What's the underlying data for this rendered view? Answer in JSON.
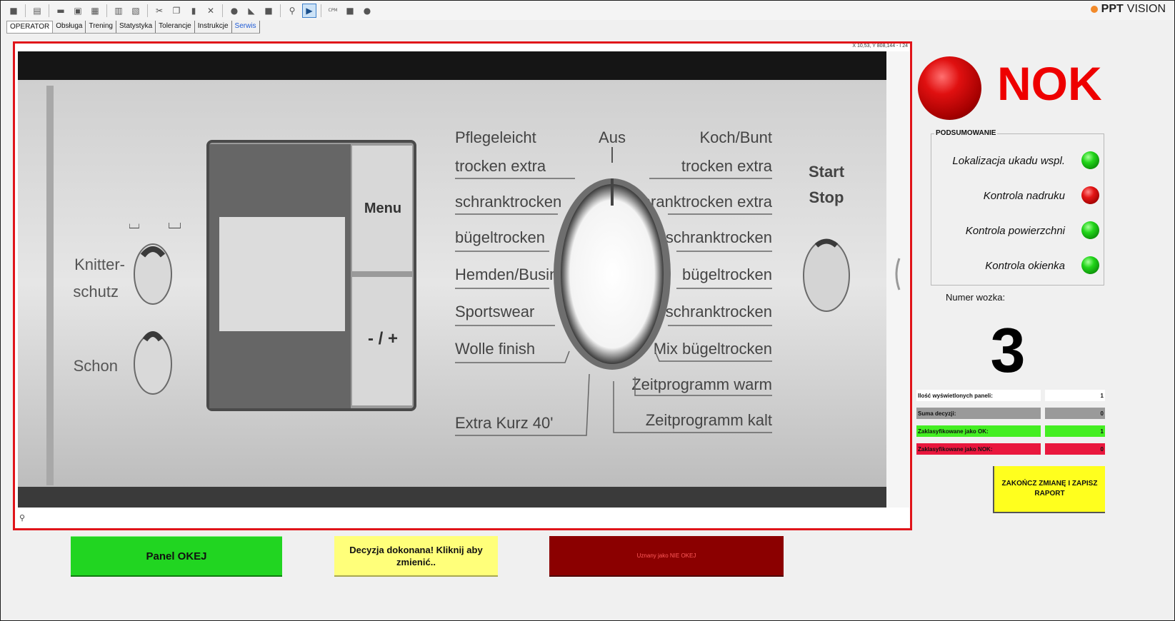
{
  "toolbar": {
    "icons": [
      "window-icon",
      "new-icon",
      "image-icon",
      "camera-icon",
      "folder-icon",
      "layers-icon",
      "export-icon",
      "scissors-icon",
      "copy-icon",
      "paste-icon",
      "delete-icon",
      "tool-icon",
      "fill-icon",
      "stop-icon",
      "search-icon",
      "play-icon",
      "cpm-icon",
      "grid-icon",
      "record-icon"
    ],
    "play_glyph": "▶",
    "cpm_glyph": "CPM"
  },
  "brand": {
    "name_bold": "PPT",
    "name_rest": "VISION",
    "accent": "#f28a2a"
  },
  "tabs": [
    {
      "label": "OPERATOR",
      "active": true
    },
    {
      "label": "Obsługa"
    },
    {
      "label": "Trening"
    },
    {
      "label": "Statystyka"
    },
    {
      "label": "Tolerancje"
    },
    {
      "label": "Instrukcje"
    },
    {
      "label": "Serwis",
      "link": true
    }
  ],
  "camera": {
    "coord_readout": "X 10,53, Y 808,144 - I 24",
    "image": {
      "left_labels": [
        "Knitter-",
        "schutz",
        "Schon"
      ],
      "menu": "Menu",
      "plusminus": "- / +",
      "program_left": [
        "Pflegeleicht",
        "trocken extra",
        "schranktrocken",
        "bügeltrocken",
        "Hemden/Business",
        "Sportswear",
        "Wolle finish",
        "Extra Kurz 40'"
      ],
      "aus": "Aus",
      "program_right": [
        "Koch/Bunt",
        "trocken extra",
        "schranktrocken extra",
        "schranktrocken",
        "bügeltrocken",
        "Mix schranktrocken",
        "Mix bügeltrocken",
        "Zeitprogramm warm",
        "Zeitprogramm kalt"
      ],
      "start": "Start",
      "stop": "Stop"
    }
  },
  "status": {
    "text": "NOK",
    "color": "#ee0000"
  },
  "summary": {
    "title": "PODSUMOWANIE",
    "items": [
      {
        "label": "Lokalizacja ukadu wspl.",
        "status": "ok"
      },
      {
        "label": "Kontrola nadruku",
        "status": "nok"
      },
      {
        "label": "Kontrola powierzchni",
        "status": "ok"
      },
      {
        "label": "Kontrola okienka",
        "status": "ok"
      }
    ]
  },
  "trolley": {
    "label": "Numer wozka:",
    "number": "3"
  },
  "stats": [
    {
      "label": "Ilość wyświetlonych paneli:",
      "value": "1"
    },
    {
      "label": "Suma decyzji:",
      "value": "0"
    },
    {
      "label": "Zaklasyfikowane jako OK:",
      "value": "1"
    },
    {
      "label": "Zaklasyfikowane jako NOK:",
      "value": "0"
    }
  ],
  "end_shift": {
    "line1": "ZAKOŃCZ ZMIANĘ I ZAPISZ",
    "line2": "RAPORT"
  },
  "buttons": {
    "ok": "Panel OKEJ",
    "decision_line1": "Decyzja dokonana! Kliknij aby",
    "decision_line2": "zmienić..",
    "nok": "Uznany jako NIE OKEJ"
  }
}
